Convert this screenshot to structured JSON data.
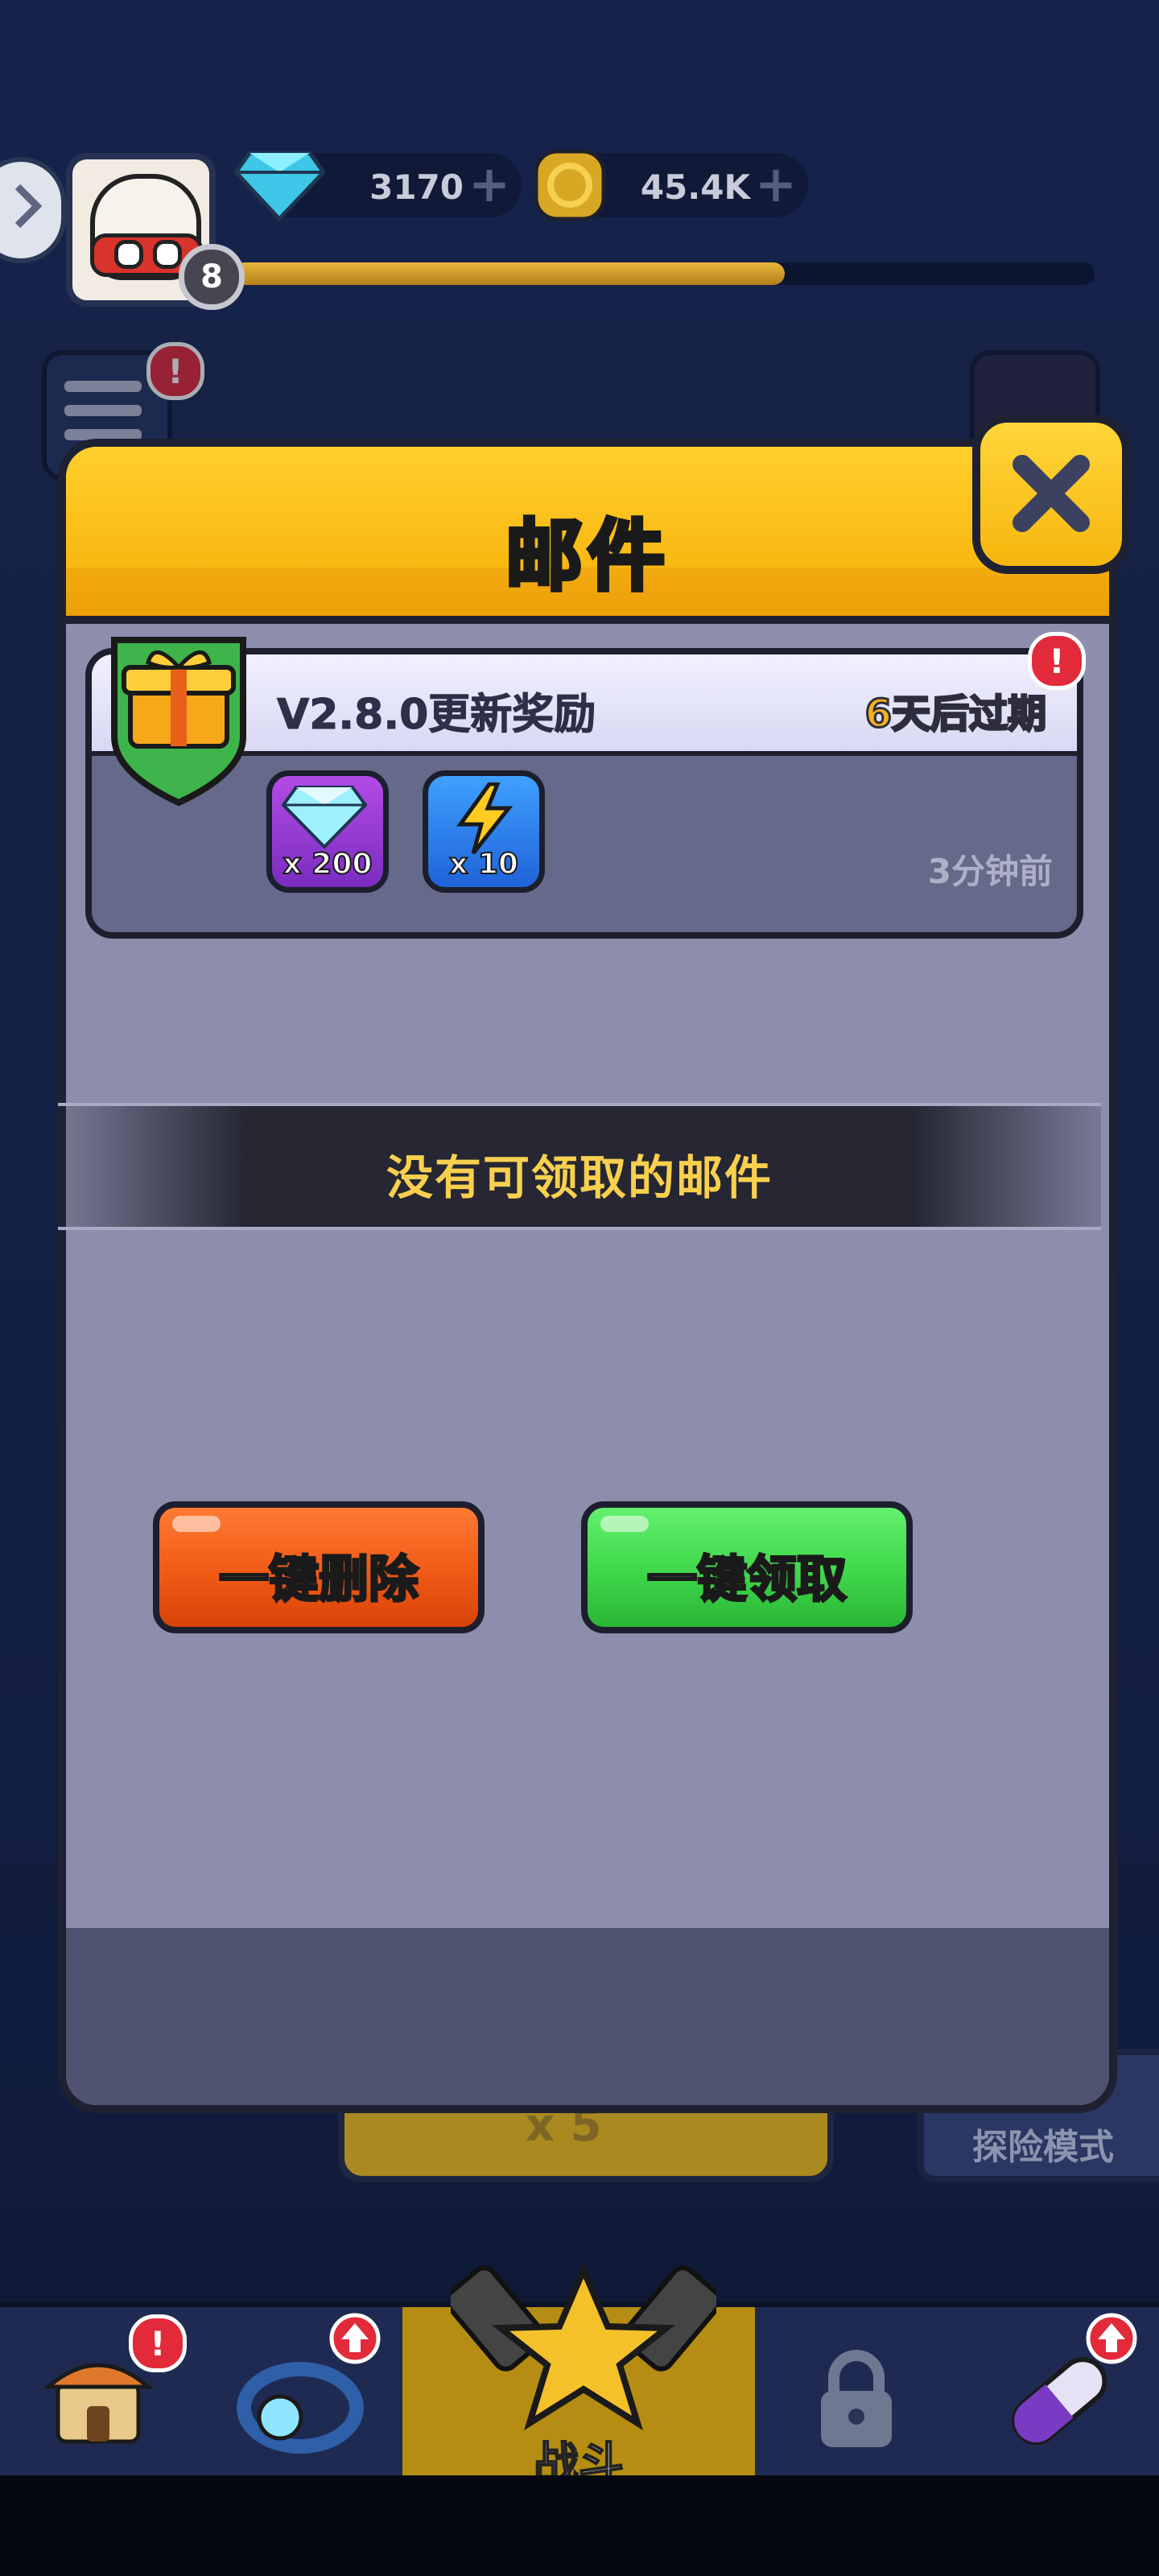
{
  "hud": {
    "gems": "3170",
    "coins": "45.4K",
    "level": "8",
    "xp_progress": 0.64
  },
  "mail_dialog": {
    "title": "邮件",
    "mail": {
      "subject": "V2.8.0更新奖励",
      "expiry": "6天后过期",
      "time_ago": "3分钟前",
      "rewards": [
        {
          "icon": "gem-icon",
          "quantity": "x 200"
        },
        {
          "icon": "lightning-icon",
          "quantity": "x 10"
        }
      ]
    },
    "empty_message": "没有可领取的邮件",
    "delete_all_label": "一键删除",
    "claim_all_label": "一键领取"
  },
  "background": {
    "battle_cost": "x 5",
    "explore_mode_label": "探险模式"
  },
  "tabbar": {
    "battle_label": "战斗",
    "tabs": [
      {
        "icon": "shop-icon",
        "alert": true
      },
      {
        "icon": "ring-icon",
        "upgrade": true
      },
      {
        "icon": "battle-icon",
        "active": true
      },
      {
        "icon": "lock-icon",
        "locked": true
      },
      {
        "icon": "capsule-icon",
        "upgrade": true
      }
    ]
  },
  "colors": {
    "header_yellow": "#f9b812",
    "delete_orange": "#f05a16",
    "claim_green": "#3ed74a",
    "expiry_gold": "#f3b21c",
    "alert_red": "#e22a3a"
  }
}
